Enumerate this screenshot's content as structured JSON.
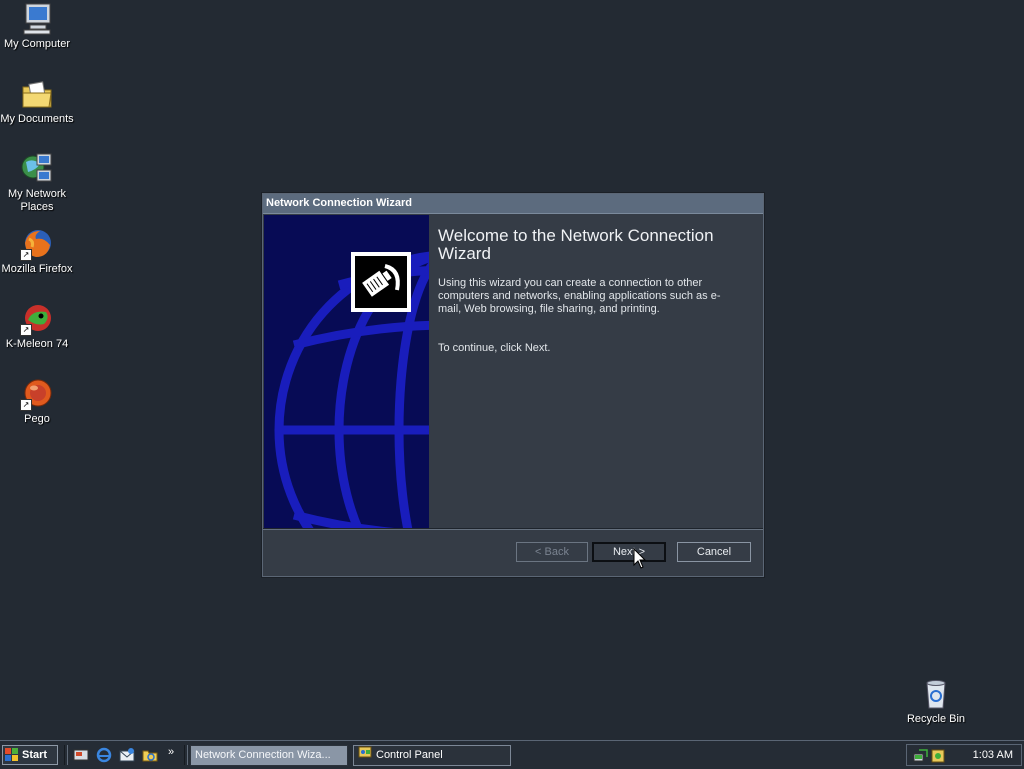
{
  "desktop": {
    "icons": [
      {
        "label": "My Computer",
        "icon": "computer-icon"
      },
      {
        "label": "My Documents",
        "icon": "folder-icon"
      },
      {
        "label": "My Network Places",
        "icon": "network-places-icon"
      },
      {
        "label": "Mozilla Firefox",
        "icon": "firefox-icon"
      },
      {
        "label": "K-Meleon 74",
        "icon": "kmeleon-icon"
      },
      {
        "label": "Pego",
        "icon": "pego-icon"
      }
    ],
    "recycle_bin": {
      "label": "Recycle Bin",
      "icon": "recycle-bin-icon"
    }
  },
  "wizard": {
    "title": "Network Connection Wizard",
    "heading": "Welcome to the Network Connection Wizard",
    "description": "Using this wizard you can create a connection to other computers and networks, enabling applications such as e-mail, Web browsing, file sharing, and printing.",
    "instruction": "To continue, click Next.",
    "buttons": {
      "back": "< Back",
      "next": "Next >",
      "cancel": "Cancel"
    }
  },
  "taskbar": {
    "start_label": "Start",
    "quick_launch": [
      "show-desktop-icon",
      "internet-explorer-icon",
      "outlook-express-icon",
      "windows-explorer-icon"
    ],
    "more": "»",
    "tasks": [
      {
        "label": "Network Connection Wiza...",
        "active": true
      },
      {
        "label": "Control Panel",
        "active": false
      }
    ],
    "clock": "1:03 AM"
  },
  "colors": {
    "desktop_bg": "#232a33",
    "titlebar": "#5c6b7e",
    "wizard_side_panel": "#070b55",
    "window_bg": "#353c46"
  }
}
